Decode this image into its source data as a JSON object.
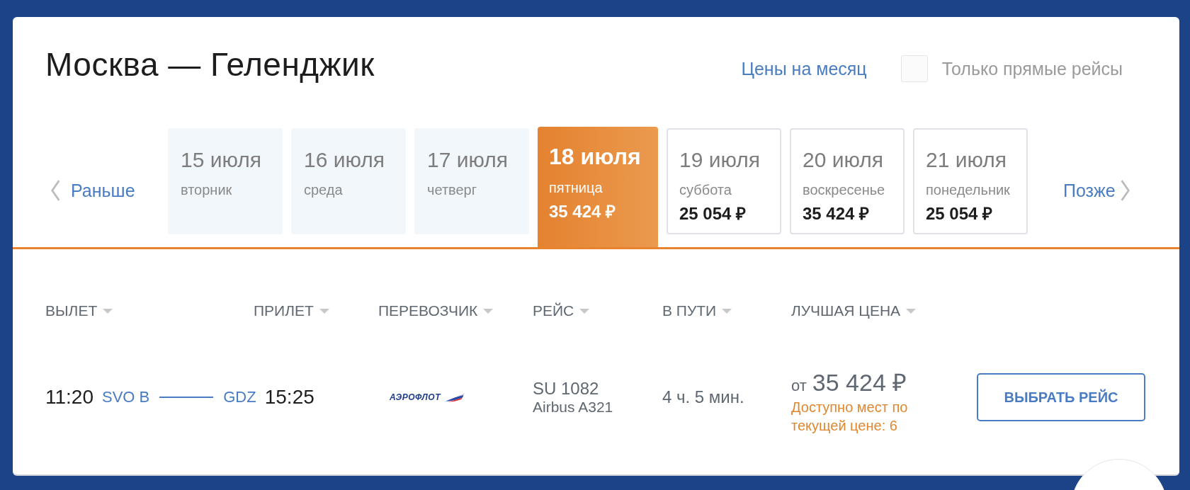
{
  "title": "Москва — Геленджик",
  "month_prices_link": "Цены на месяц",
  "direct_only": {
    "label": "Только прямые рейсы",
    "checked": false
  },
  "earlier": "Раньше",
  "later": "Позже",
  "dates": [
    {
      "date": "15 июля",
      "weekday": "вторник",
      "disabled": true,
      "selected": false
    },
    {
      "date": "16 июля",
      "weekday": "среда",
      "disabled": true,
      "selected": false
    },
    {
      "date": "17 июля",
      "weekday": "четверг",
      "disabled": true,
      "selected": false
    },
    {
      "date": "18 июля",
      "weekday": "пятница",
      "price": "35 424 ₽",
      "disabled": false,
      "selected": true
    },
    {
      "date": "19 июля",
      "weekday": "суббота",
      "price": "25 054 ₽",
      "disabled": false,
      "selected": false
    },
    {
      "date": "20 июля",
      "weekday": "воскресенье",
      "price": "35 424 ₽",
      "disabled": false,
      "selected": false
    },
    {
      "date": "21 июля",
      "weekday": "понедельник",
      "price": "25 054 ₽",
      "disabled": false,
      "selected": false
    }
  ],
  "columns": [
    "ВЫЛЕТ",
    "ПРИЛЕТ",
    "ПЕРЕВОЗЧИК",
    "РЕЙС",
    "В ПУТИ",
    "ЛУЧШАЯ ЦЕНА"
  ],
  "flights": [
    {
      "departure_time": "11:20",
      "departure_airport": "SVO B",
      "arrival_airport": "GDZ",
      "arrival_time": "15:25",
      "carrier": "АЭРОФЛОТ",
      "flight": "SU 1082",
      "aircraft": "Airbus A321",
      "duration": "4 ч. 5 мин.",
      "price_prefix": "от",
      "price": "35 424 ₽",
      "seats_note": "Доступно мест по текущей цене: 6",
      "button": "ВЫБРАТЬ РЕЙС"
    }
  ]
}
